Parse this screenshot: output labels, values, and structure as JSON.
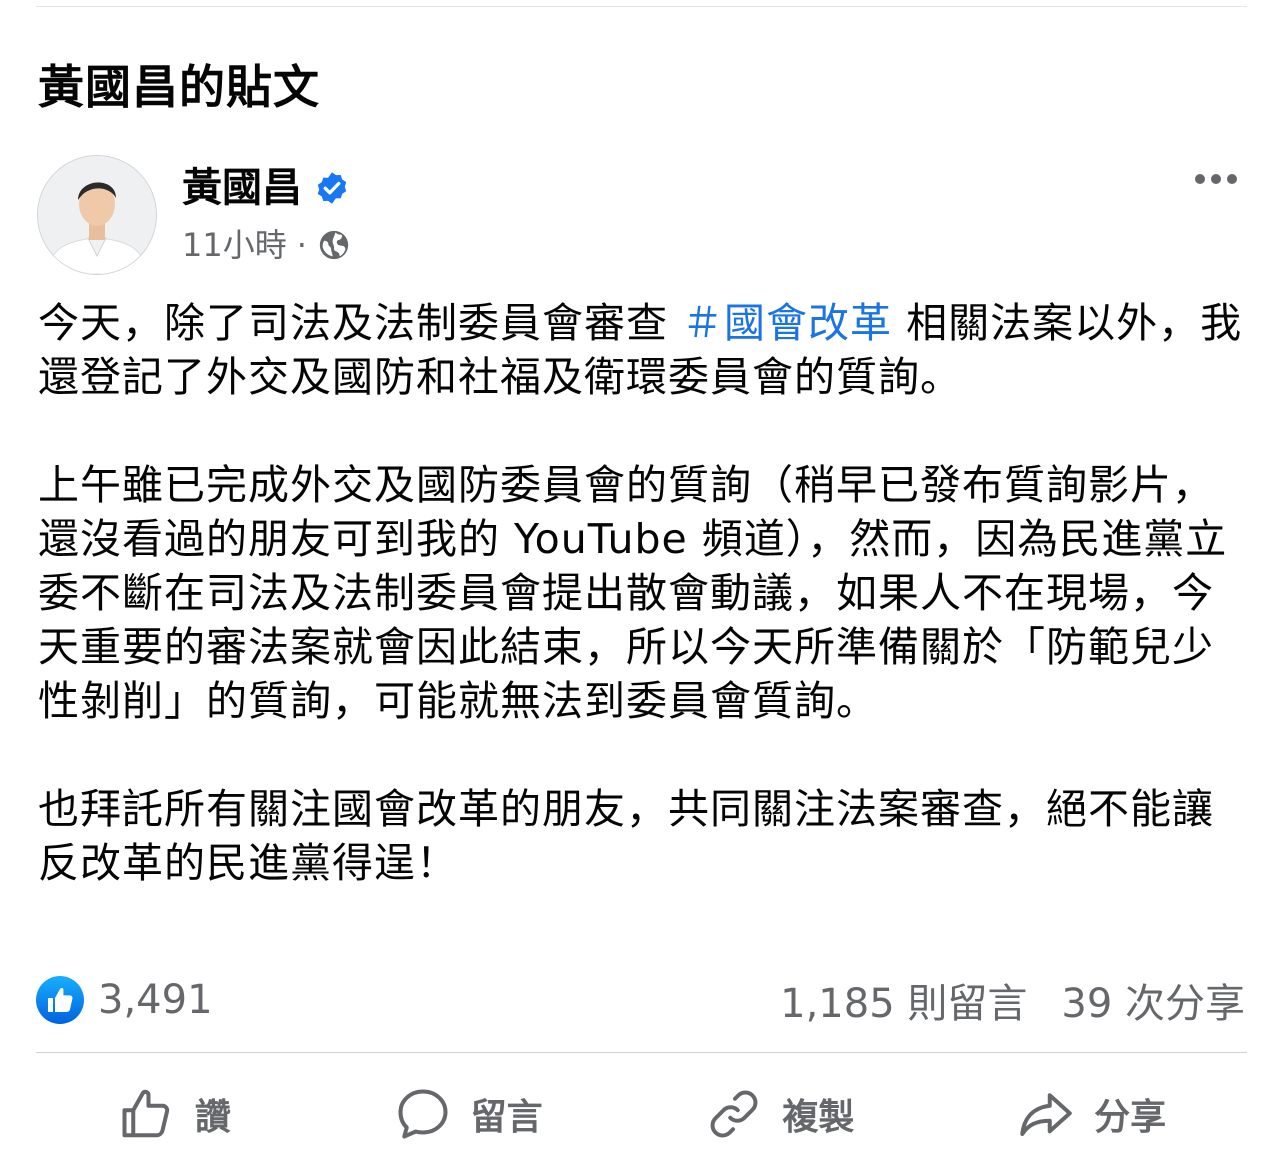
{
  "header": {
    "title": "黃國昌的貼文"
  },
  "post": {
    "author": "黃國昌",
    "time": "11小時",
    "separator": "·",
    "intro_before": "今天，除了司法及法制委員會審查 ",
    "hashtag": "＃國會改革",
    "intro_after": " 相關法案以外，我還登記了外交及國防和社福及衛環委員會的質詢。",
    "paragraph2": "上午雖已完成外交及國防委員會的質詢（稍早已發布質詢影片，還沒看過的朋友可到我的 YouTube 頻道），然而，因為民進黨立委不斷在司法及法制委員會提出散會動議，如果人不在現場，今天重要的審法案就會因此結束，所以今天所準備關於「防範兒少性剝削」的質詢，可能就無法到委員會質詢。",
    "paragraph3": "也拜託所有關注國會改革的朋友，共同關注法案審查，絕不能讓反改革的民進黨得逞！"
  },
  "stats": {
    "likes": "3,491",
    "comments": "1,185 則留言",
    "shares": "39 次分享"
  },
  "actions": {
    "like": "讚",
    "comment": "留言",
    "copy": "複製",
    "share": "分享"
  },
  "icons": {
    "verified": "verified-badge-icon",
    "audience": "globe-icon",
    "more": "more-options-icon",
    "like": "thumbs-up-icon",
    "comment": "speech-bubble-icon",
    "copy": "link-icon",
    "share": "share-arrow-icon"
  },
  "colors": {
    "link": "#1b74e4",
    "accent": "#1877f2",
    "muted": "#65676b"
  }
}
